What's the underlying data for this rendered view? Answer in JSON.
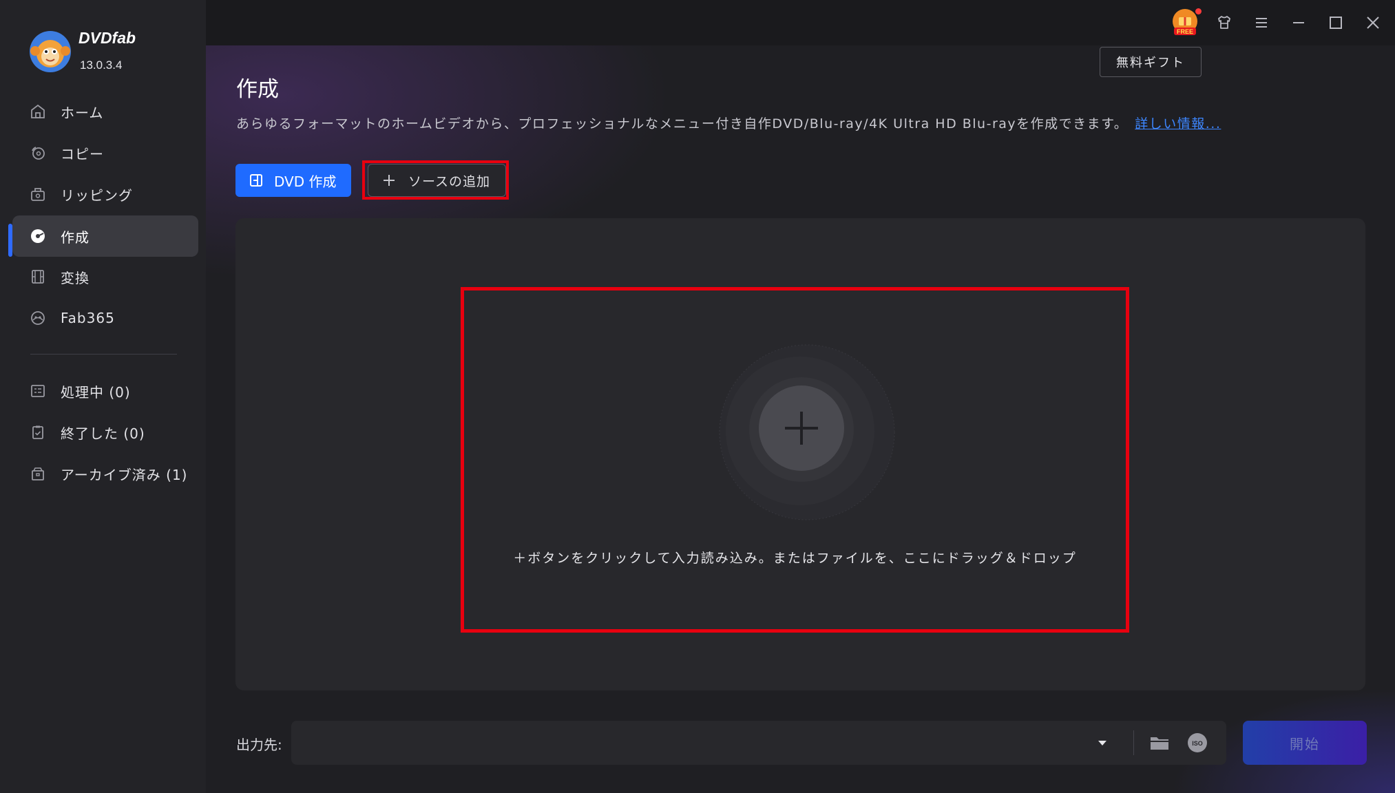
{
  "app": {
    "brand": "DVDfab",
    "version": "13.0.3.4"
  },
  "sidebar": {
    "items": [
      {
        "label": "ホーム",
        "icon": "home-icon"
      },
      {
        "label": "コピー",
        "icon": "copy-disc-icon"
      },
      {
        "label": "リッピング",
        "icon": "ripper-icon"
      },
      {
        "label": "作成",
        "icon": "creator-disc-icon",
        "active": true
      },
      {
        "label": "変換",
        "icon": "film-icon"
      },
      {
        "label": "Fab365",
        "icon": "fab365-icon"
      }
    ],
    "tasks": [
      {
        "label": "処理中 (0)",
        "icon": "processing-list-icon"
      },
      {
        "label": "終了した (0)",
        "icon": "finished-clipboard-icon"
      },
      {
        "label": "アーカイブ済み (1)",
        "icon": "archive-box-icon"
      }
    ]
  },
  "titlebar": {
    "free_badge": "FREE",
    "gift_tooltip": "無料ギフト",
    "icons": [
      "free-gift-icon",
      "shirt-icon",
      "menu-icon",
      "minimize-icon",
      "maximize-icon",
      "close-icon"
    ]
  },
  "page": {
    "title": "作成",
    "description": "あらゆるフォーマットのホームビデオから、プロフェッショナルなメニュー付き自作DVD/Blu-ray/4K Ultra HD Blu-rayを作成できます。",
    "more_link": "詳しい情報..."
  },
  "toolbar": {
    "mode_label": "DVD 作成",
    "add_source_label": "ソースの追加"
  },
  "dropzone": {
    "hint": "＋ボタンをクリックして入力読み込み。またはファイルを、ここにドラッグ＆ドロップ"
  },
  "output": {
    "label": "出力先:",
    "value": "",
    "iso_label": "ISO",
    "start_label": "開始"
  },
  "colors": {
    "accent": "#1f6bff",
    "highlight": "#e8000f",
    "link": "#3d86ff"
  }
}
